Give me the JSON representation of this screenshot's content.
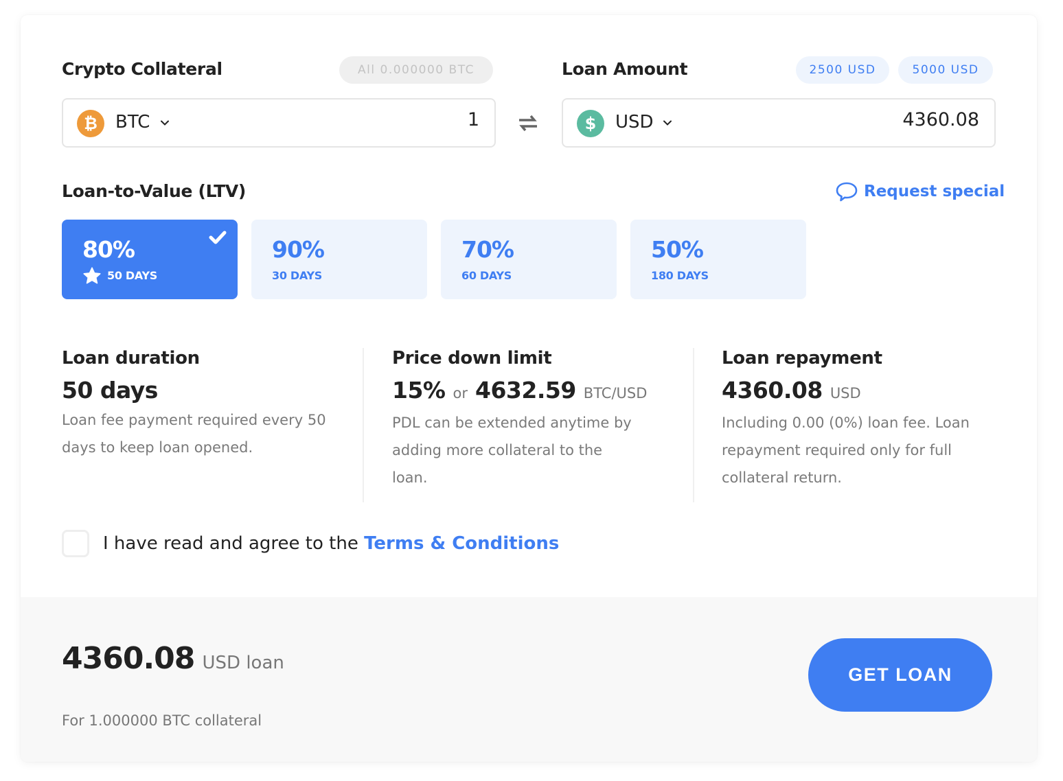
{
  "collateral": {
    "title": "Crypto Collateral",
    "all_button": "All 0.000000 BTC",
    "currency": "BTC",
    "currency_icon": "bitcoin-icon",
    "currency_icon_glyph": "₿",
    "amount": "1"
  },
  "swap_icon": "swap-arrows-icon",
  "loan": {
    "title": "Loan Amount",
    "presets": [
      "2500 USD",
      "5000 USD"
    ],
    "currency": "USD",
    "currency_icon": "dollar-icon",
    "currency_icon_glyph": "$",
    "amount": "4360.08"
  },
  "ltv": {
    "title": "Loan-to-Value (LTV)",
    "request_special": "Request special",
    "options": [
      {
        "percent": "80%",
        "days": "50 DAYS",
        "selected": true,
        "recommended": true
      },
      {
        "percent": "90%",
        "days": "30 DAYS",
        "selected": false
      },
      {
        "percent": "70%",
        "days": "60 DAYS",
        "selected": false
      },
      {
        "percent": "50%",
        "days": "180 DAYS",
        "selected": false
      }
    ]
  },
  "info": {
    "duration": {
      "title": "Loan duration",
      "value": "50 days",
      "description": "Loan fee payment required every 50 days to keep loan opened."
    },
    "pdl": {
      "title": "Price down limit",
      "percent": "15%",
      "or": "or",
      "price": "4632.59",
      "pair": "BTC/USD",
      "description": "PDL can be extended anytime by adding more collateral to the loan."
    },
    "repayment": {
      "title": "Loan repayment",
      "value": "4360.08",
      "unit": "USD",
      "description": "Including 0.00 (0%) loan fee. Loan repayment required only for full collateral return."
    }
  },
  "terms": {
    "checked": false,
    "text": "I have read and agree to the ",
    "link": "Terms & Conditions"
  },
  "summary": {
    "amount": "4360.08",
    "unit": "USD loan",
    "subtext": "For 1.000000 BTC collateral",
    "button": "GET LOAN"
  },
  "colors": {
    "accent": "#3f7ef2",
    "accent_light": "#eef4fd",
    "btc": "#ee9a3a",
    "usd": "#5bbba0"
  }
}
